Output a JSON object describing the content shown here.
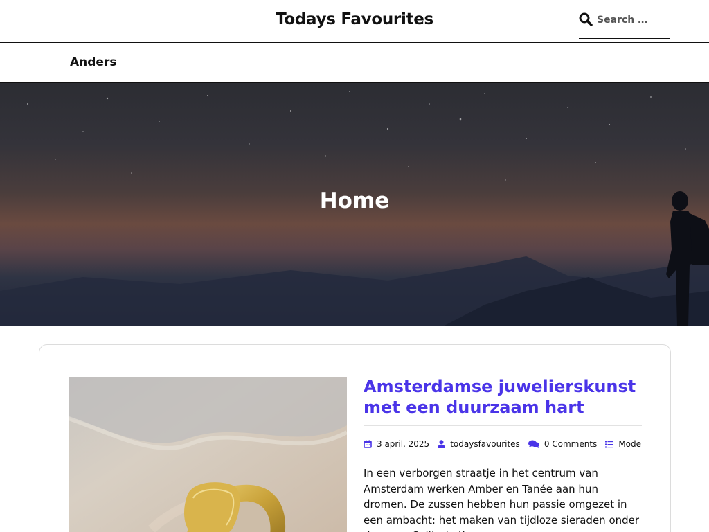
{
  "header": {
    "site_title": "Todays Favourites",
    "search_placeholder": "Search …",
    "search_icon": "search-icon"
  },
  "nav": {
    "items": [
      {
        "label": "Anders"
      }
    ]
  },
  "hero": {
    "title": "Home"
  },
  "post": {
    "title": "Amsterdamse juwelierskunst met een duurzaam hart",
    "date": "3 april, 2025",
    "author": "todaysfavourites",
    "comments": "0 Comments",
    "category": "Mode",
    "excerpt": "In een verborgen straatje in het centrum van Amsterdam werken Amber en Tanée aan hun dromen. De zussen hebben hun passie omgezet in een ambacht: het maken van tijdloze sieraden onder de naam Solitude the",
    "icons": {
      "date": "calendar-icon",
      "author": "user-icon",
      "comments": "comments-icon",
      "category": "list-icon"
    }
  },
  "colors": {
    "accent": "#4a34e8",
    "text": "#111111",
    "border": "#111111"
  }
}
